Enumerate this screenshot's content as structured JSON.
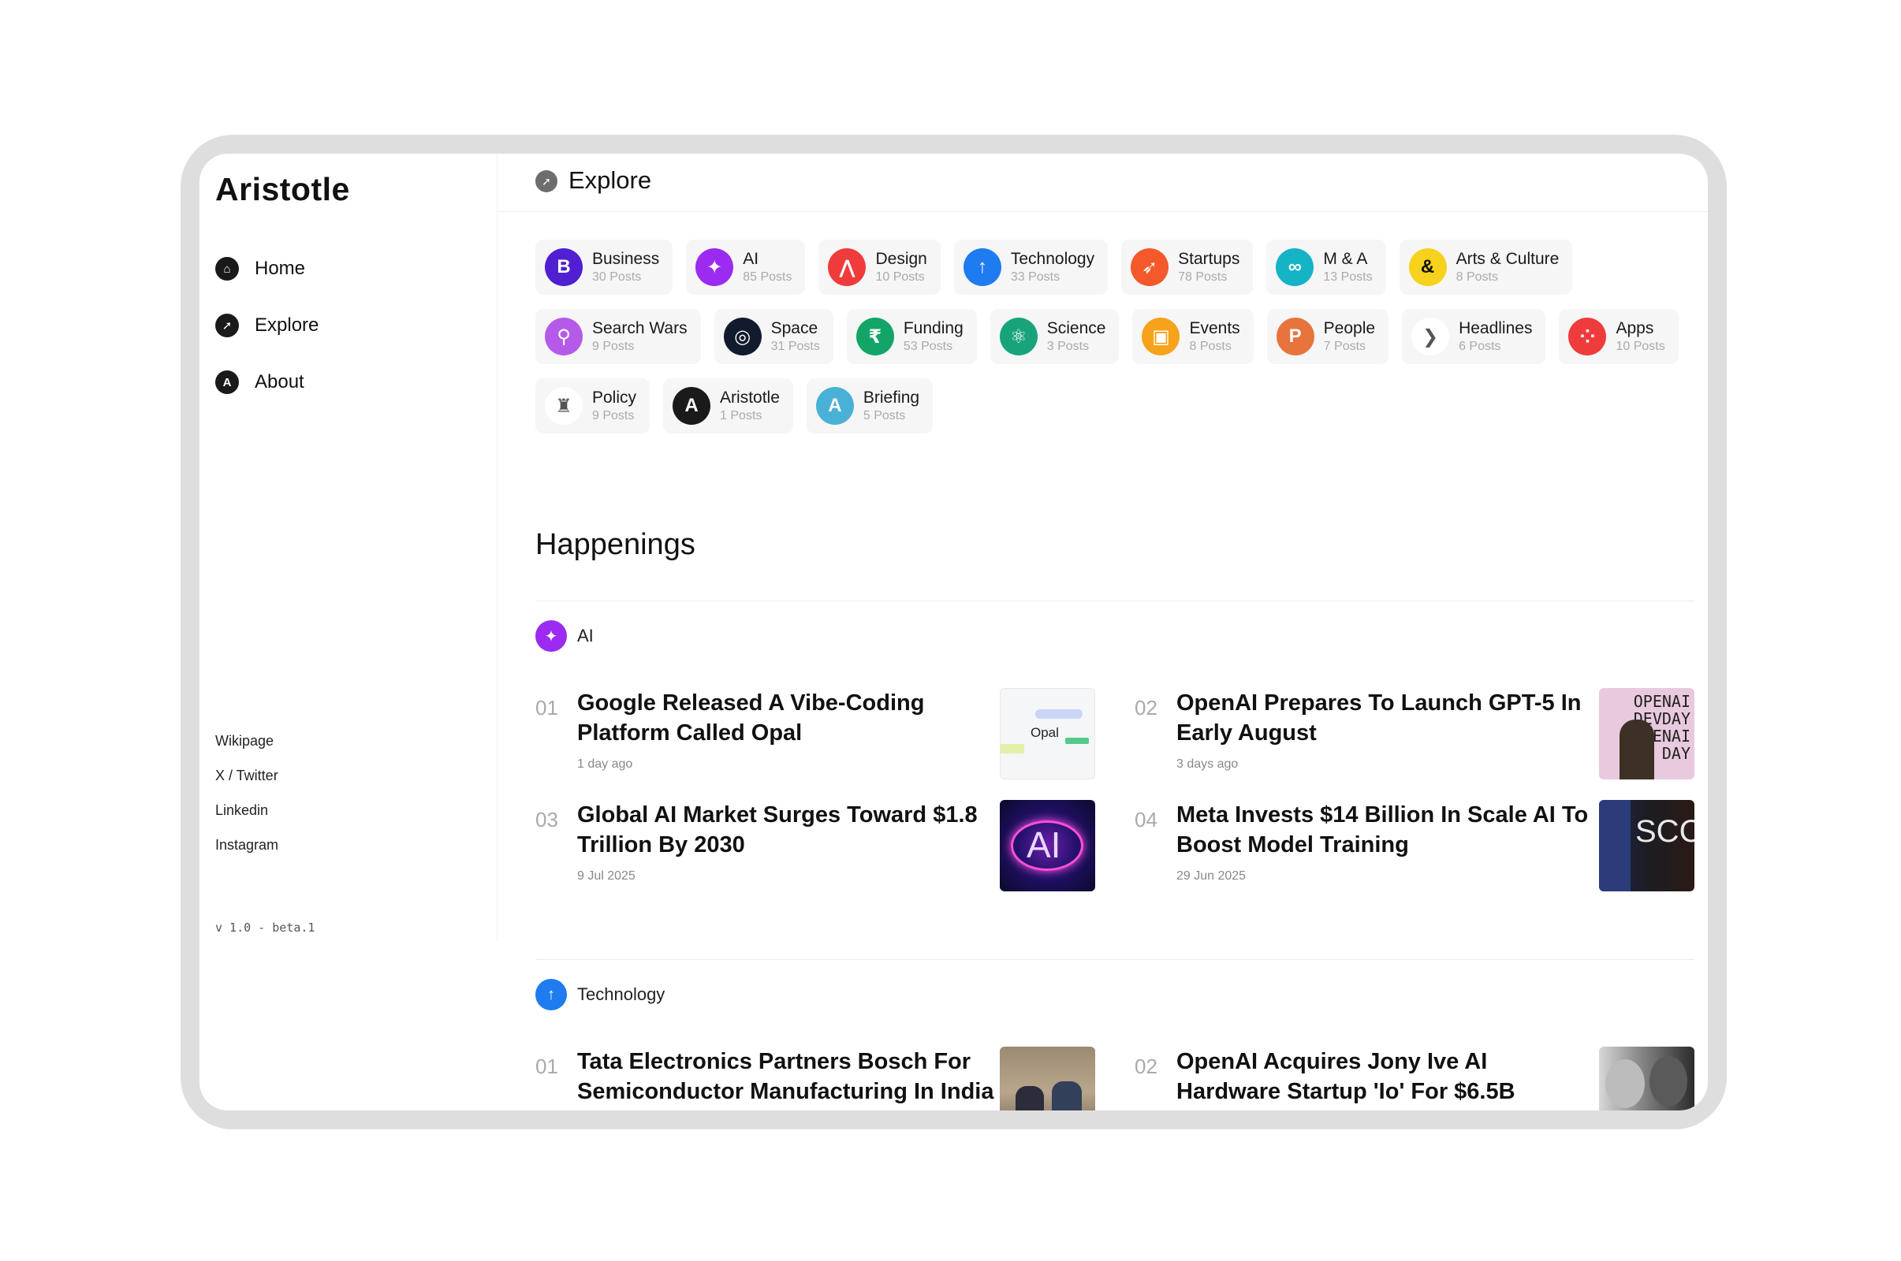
{
  "brand": "Aristotle",
  "nav": [
    {
      "label": "Home",
      "icon": "home-icon",
      "glyph": "⌂"
    },
    {
      "label": "Explore",
      "icon": "compass-icon",
      "glyph": "➚"
    },
    {
      "label": "About",
      "icon": "about-icon",
      "glyph": "A"
    }
  ],
  "links": [
    "Wikipage",
    "X / Twitter",
    "Linkedin",
    "Instagram"
  ],
  "version": "v 1.0 - beta.1",
  "topbar": {
    "title": "Explore",
    "icon": "compass-icon"
  },
  "categories": [
    [
      {
        "name": "Business",
        "count": "30 Posts",
        "glyph": "B",
        "color": "#4f1fd1",
        "icon": "business-icon"
      },
      {
        "name": "AI",
        "count": "85 Posts",
        "glyph": "✦",
        "color": "#9b2bf0",
        "icon": "ai-sparkle-icon"
      },
      {
        "name": "Design",
        "count": "10 Posts",
        "glyph": "⋀",
        "color": "#ef3b3b",
        "icon": "design-compass-icon"
      },
      {
        "name": "Technology",
        "count": "33 Posts",
        "glyph": "↑",
        "color": "#1f7bf0",
        "icon": "technology-icon"
      },
      {
        "name": "Startups",
        "count": "78 Posts",
        "glyph": "➶",
        "color": "#f4592b",
        "icon": "rocket-icon"
      },
      {
        "name": "M & A",
        "count": "13 Posts",
        "glyph": "∞",
        "color": "#14b3c6",
        "icon": "merge-icon"
      },
      {
        "name": "Arts & Culture",
        "count": "8 Posts",
        "glyph": "&",
        "color": "#f7d21c",
        "icon": "ampersand-icon"
      }
    ],
    [
      {
        "name": "Search Wars",
        "count": "9 Posts",
        "glyph": "⚲",
        "color": "#b55ae8",
        "icon": "search-icon"
      },
      {
        "name": "Space",
        "count": "31 Posts",
        "glyph": "◎",
        "color": "#121a2e",
        "icon": "galaxy-icon"
      },
      {
        "name": "Funding",
        "count": "53 Posts",
        "glyph": "₹",
        "color": "#13a568",
        "icon": "rupee-icon"
      },
      {
        "name": "Science",
        "count": "3 Posts",
        "glyph": "⚛",
        "color": "#19a37a",
        "icon": "atom-icon"
      },
      {
        "name": "Events",
        "count": "8 Posts",
        "glyph": "▣",
        "color": "#f6a21b",
        "icon": "calendar-icon"
      },
      {
        "name": "People",
        "count": "7 Posts",
        "glyph": "P",
        "color": "#e7743d",
        "icon": "people-icon"
      },
      {
        "name": "Headlines",
        "count": "6 Posts",
        "glyph": "❯",
        "color": "#ffffff",
        "icon": "headlines-icon"
      },
      {
        "name": "Apps",
        "count": "10 Posts",
        "glyph": "⁘",
        "color": "#ef3b3b",
        "icon": "apps-grid-icon"
      }
    ],
    [
      {
        "name": "Policy",
        "count": "9 Posts",
        "glyph": "♜",
        "color": "#f6f6f6",
        "icon": "emblem-icon"
      },
      {
        "name": "Aristotle",
        "count": "1 Posts",
        "glyph": "A",
        "color": "#1a1a1a",
        "icon": "aristotle-icon"
      },
      {
        "name": "Briefing",
        "count": "5 Posts",
        "glyph": "A",
        "color": "#49b1d6",
        "icon": "briefing-icon"
      }
    ]
  ],
  "happenings_title": "Happenings",
  "sections": [
    {
      "label": "AI",
      "glyph": "✦",
      "color": "#9b2bf0",
      "icon": "ai-sparkle-icon",
      "articles": [
        {
          "num": "01",
          "title": "Google Released A Vibe-Coding Platform Called Opal",
          "date": "1 day ago",
          "thumb": "opal",
          "thumb_text": "Opal"
        },
        {
          "num": "02",
          "title": "OpenAI Prepares To Launch GPT-5 In Early August",
          "date": "3 days ago",
          "thumb": "openai",
          "thumb_text": "OPENAI DEVDAY OPENAI DAY"
        },
        {
          "num": "03",
          "title": "Global AI Market Surges Toward $1.8 Trillion By 2030",
          "date": "9 Jul 2025",
          "thumb": "ai",
          "thumb_text": "AI"
        },
        {
          "num": "04",
          "title": "Meta Invests $14 Billion In Scale AI To Boost Model Training",
          "date": "29 Jun 2025",
          "thumb": "scale",
          "thumb_text": "SCC"
        }
      ]
    },
    {
      "label": "Technology",
      "glyph": "↑",
      "color": "#1f7bf0",
      "icon": "technology-icon",
      "articles": [
        {
          "num": "01",
          "title": "Tata Electronics Partners Bosch For Semiconductor Manufacturing In India",
          "date": "",
          "thumb": "tata",
          "thumb_text": ""
        },
        {
          "num": "02",
          "title": "OpenAI Acquires Jony Ive AI Hardware Startup 'Io' For $6.5B",
          "date": "",
          "thumb": "jony",
          "thumb_text": ""
        }
      ]
    }
  ]
}
